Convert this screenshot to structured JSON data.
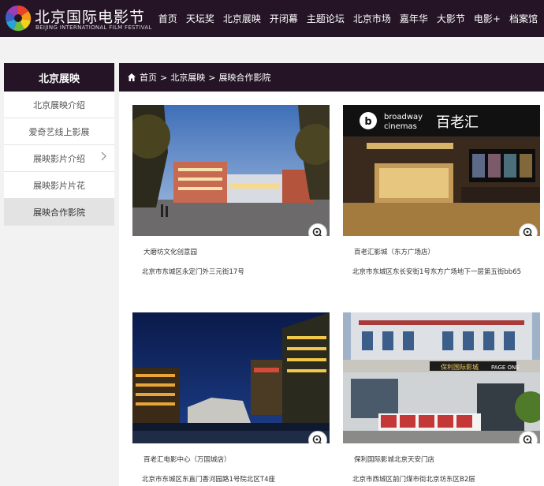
{
  "header": {
    "logo_cn": "北京国际电影节",
    "logo_en": "BEIJING INTERNATIONAL FILM FESTIVAL",
    "nav": [
      {
        "label": "首页"
      },
      {
        "label": "天坛奖"
      },
      {
        "label": "北京展映"
      },
      {
        "label": "开闭幕"
      },
      {
        "label": "主题论坛"
      },
      {
        "label": "北京市场"
      },
      {
        "label": "嘉年华"
      },
      {
        "label": "大影节"
      },
      {
        "label": "电影+"
      },
      {
        "label": "档案馆"
      }
    ]
  },
  "sidebar": {
    "title": "北京展映",
    "items": [
      {
        "label": "北京展映介绍"
      },
      {
        "label": "爱奇艺线上影展"
      },
      {
        "label": "展映影片介绍"
      },
      {
        "label": "展映影片片花"
      },
      {
        "label": "展映合作影院"
      }
    ],
    "active_index": 4
  },
  "breadcrumb": {
    "home": "首页",
    "sep": ">",
    "section": "北京展映",
    "current": "展映合作影院"
  },
  "cinemas": [
    {
      "name": "大磨坊文化创意园",
      "address": "北京市东城区永定门外三元街17号"
    },
    {
      "name": "百老汇影城（东方广场店）",
      "address": "北京市东城区东长安街1号东方广场地下一层第五街bb65"
    },
    {
      "name": "百老汇电影中心（万国城店）",
      "address": "北京市东城区东直门香河园路1号院北区T4座"
    },
    {
      "name": "保利国际影城北京天安门店",
      "address": "北京市西城区前门煤市街北京坊东区B2层"
    }
  ],
  "photo_text": {
    "broadway_en": "broadway",
    "broadway_en2": "cinemas",
    "broadway_cn": "百老汇",
    "poly_sign": "保利国际影城",
    "poly_sign_en": "PAGE ONE"
  },
  "colors": {
    "header_bg": "#241426",
    "page_bg": "#f2f2f2",
    "active_item_bg": "#e3e3e3"
  }
}
